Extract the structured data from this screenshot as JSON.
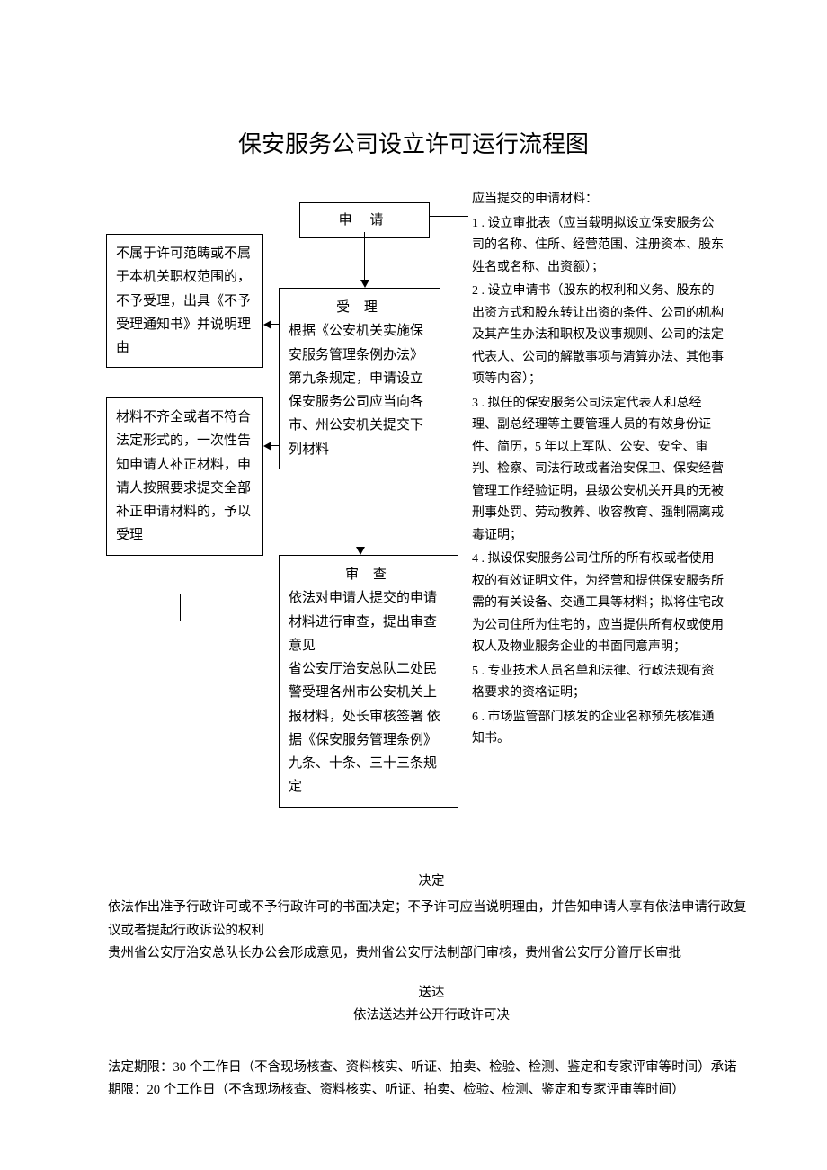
{
  "title": "保安服务公司设立许可运行流程图",
  "flow": {
    "apply": "申  请",
    "accept_title": "受    理",
    "accept_body": "根据《公安机关实施保安服务管理条例办法》第九条规定，申请设立保安服务公司应当向各市、州公安机关提交下列材料",
    "review_title": "审    查",
    "review_body": "依法对申请人提交的申请材料进行审查，提出审查意见\n省公安厅治安总队二处民警受理各州市公安机关上报材料，处长审核签署 依据《保安服务管理条例》九条、十条、三十三条规定",
    "reject_scope": "不属于许可范畴或不属于本机关职权范围的，不予受理，出具《不予受理通知书》并说明理由",
    "incomplete": "材料不齐全或者不符合法定形式的，一次性告知申请人补正材料，申请人按照要求提交全部补正申请材料的，予以受理"
  },
  "materials": {
    "head": "应当提交的申请材料：",
    "m1": "1 . 设立审批表（应当载明拟设立保安服务公司的名称、住所、经营范围、注册资本、股东姓名或名称、出资额）；",
    "m2": "2 . 设立申请书（股东的权利和义务、股东的出资方式和股东转让出资的条件、公司的机构及其产生办法和职权及议事规则、公司的法定代表人、公司的解散事项与清算办法、其他事项等内容）；",
    "m3": "3 . 拟任的保安服务公司法定代表人和总经理、副总经理等主要管理人员的有效身份证件、简历，5 年以上军队、公安、安全、审判、检察、司法行政或者治安保卫、保安经营管理工作经验证明，县级公安机关开具的无被刑事处罚、劳动教养、收容教育、强制隔离戒毒证明；",
    "m4": "4 . 拟设保安服务公司住所的所有权或者使用权的有效证明文件，为经营和提供保安服务所需的有关设备、交通工具等材料；拟将住宅改为公司住所为住宅的，应当提供所有权或使用权人及物业服务企业的书面同意声明；",
    "m5": "5 . 专业技术人员名单和法律、行政法规有资格要求的资格证明；",
    "m6": "6 . 市场监管部门核发的企业名称预先核准通知书。"
  },
  "decide": {
    "title": "决定",
    "line1": "依法作出准予行政许可或不予行政许可的书面决定；不予许可应当说明理由，并告知申请人享有依法申请行政复议或者提起行政诉讼的权利",
    "line2": "贵州省公安厅治安总队长办公会形成意见，贵州省公安厅法制部门审核，贵州省公安厅分管厅长审批"
  },
  "deliver": {
    "title": "送达",
    "body": "依法送达并公开行政许可决"
  },
  "deadline": {
    "line1": "法定期限：30 个工作日（不含现场核查、资料核实、听证、拍卖、检验、检测、鉴定和专家评审等时间）承诺",
    "line2": "期限：20 个工作日（不含现场核查、资料核实、听证、拍卖、检验、检测、鉴定和专家评审等时间）"
  }
}
